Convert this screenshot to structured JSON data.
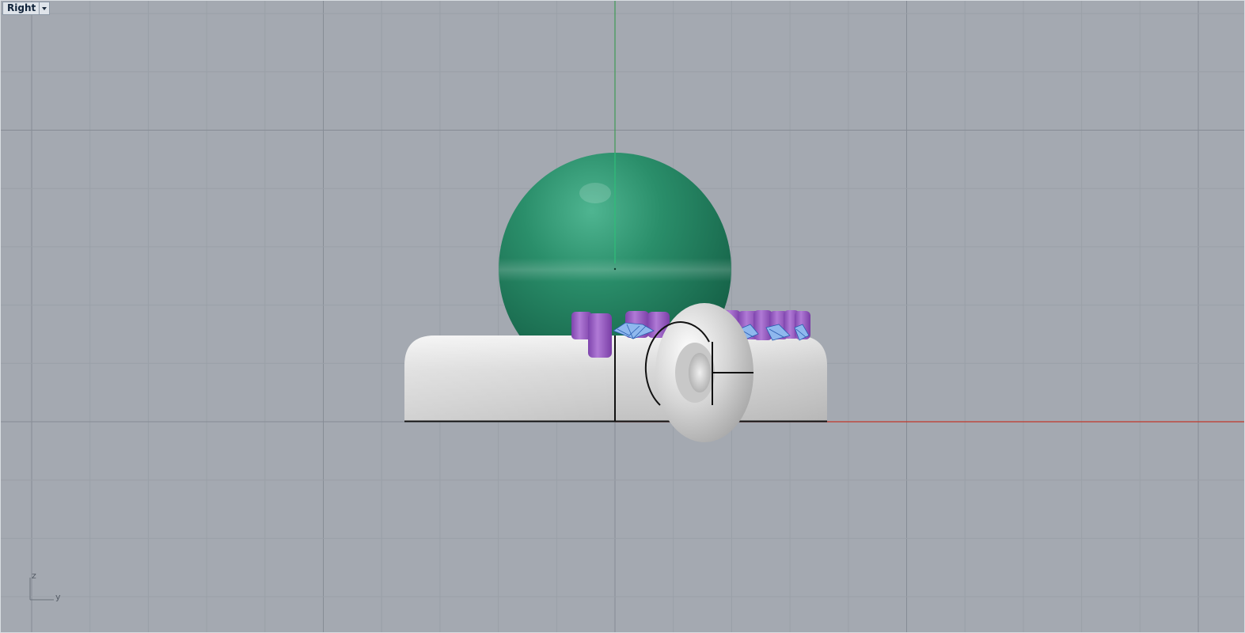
{
  "viewport": {
    "name": "Right",
    "axis_icon": {
      "vertical_label": "z",
      "horizontal_label": "y"
    }
  },
  "colors": {
    "background": "#a4a9b1",
    "grid_minor": "#9aa0a8",
    "grid_major": "#868c95",
    "x_axis": "#c0392b",
    "z_axis": "#3f9b55",
    "sphere": "#1e7c5a",
    "body": "#d6d6d6",
    "prongs": "#9b5fc7",
    "gems": "#8fb8ee"
  },
  "objects": [
    {
      "name": "green-sphere",
      "type": "sphere-icon"
    },
    {
      "name": "base-body",
      "type": "rounded-box-icon"
    },
    {
      "name": "torus-ring",
      "type": "torus-icon"
    },
    {
      "name": "prongs",
      "type": "cylinder-icon"
    },
    {
      "name": "gemstones",
      "type": "gem-icon"
    }
  ]
}
